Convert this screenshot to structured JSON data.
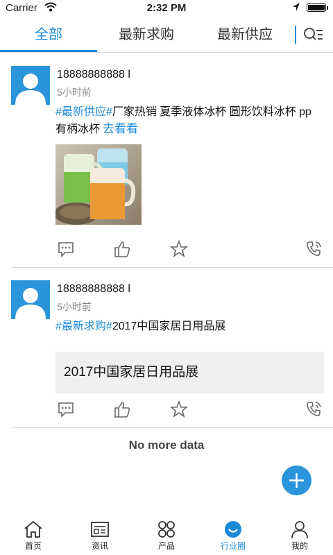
{
  "status_bar": {
    "carrier": "Carrier",
    "time": "2:32 PM"
  },
  "tabs": [
    {
      "label": "全部",
      "active": true
    },
    {
      "label": "最新求购",
      "active": false
    },
    {
      "label": "最新供应",
      "active": false
    }
  ],
  "filter_icon": "search-list-icon",
  "posts": [
    {
      "user": "18888888888 l",
      "time": "5小时前",
      "tag": "#最新供应#",
      "text": "厂家热销 夏季液体冰杯 圆形饮料冰杯 pp有柄冰杯",
      "link": "去看看"
    },
    {
      "user": "18888888888 l",
      "time": "5小时前",
      "tag": "#最新求购#",
      "text": "2017中国家居日用品展",
      "quote": "2017中国家居日用品展"
    }
  ],
  "post_actions": [
    "comment-icon",
    "like-icon",
    "star-icon",
    "phone-icon"
  ],
  "no_more": "No more data",
  "bottom_nav": [
    {
      "label": "首页",
      "icon": "home-icon",
      "active": false
    },
    {
      "label": "资讯",
      "icon": "news-icon",
      "active": false
    },
    {
      "label": "产品",
      "icon": "product-grid-icon",
      "active": false
    },
    {
      "label": "行业圈",
      "icon": "circle-smile-icon",
      "active": true
    },
    {
      "label": "我的",
      "icon": "user-icon",
      "active": false
    }
  ],
  "colors": {
    "accent": "#1d8ad8",
    "avatar_bg": "#2b95db",
    "fab": "#2b95db"
  }
}
